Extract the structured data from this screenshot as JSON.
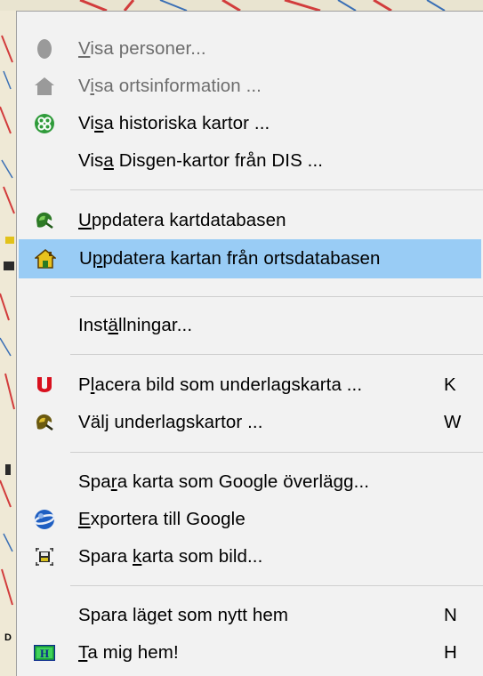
{
  "menu": {
    "items": [
      {
        "pre": "",
        "acc": "V",
        "post": "isa personer...",
        "key": "",
        "disabled": true,
        "icon": "person-icon"
      },
      {
        "pre": "V",
        "acc": "i",
        "post": "sa ortsinformation ...",
        "key": "",
        "disabled": true,
        "icon": "house-icon"
      },
      {
        "pre": "Vi",
        "acc": "s",
        "post": "a historiska kartor ...",
        "key": "",
        "disabled": false,
        "icon": "historical-maps-icon"
      },
      {
        "pre": "Vis",
        "acc": "a",
        "post": " Disgen-kartor från DIS ...",
        "key": "",
        "disabled": false,
        "icon": ""
      },
      {
        "pre": "",
        "acc": "U",
        "post": "ppdatera kartdatabasen",
        "key": "",
        "disabled": false,
        "icon": "map-update-icon"
      },
      {
        "pre": "U",
        "acc": "p",
        "post": "pdatera kartan från ortsdatabasen",
        "key": "",
        "disabled": false,
        "icon": "house-update-icon",
        "highlighted": true
      },
      {
        "pre": "Inst",
        "acc": "ä",
        "post": "llningar...",
        "key": "",
        "disabled": false,
        "icon": ""
      },
      {
        "pre": "P",
        "acc": "l",
        "post": "acera bild som underlagskarta ...",
        "key": "K",
        "disabled": false,
        "icon": "underlay-u-icon"
      },
      {
        "pre": "Väl",
        "acc": "j",
        "post": " underlagskartor ...",
        "key": "W",
        "disabled": false,
        "icon": "choose-underlay-icon"
      },
      {
        "pre": "Spa",
        "acc": "r",
        "post": "a karta som Google överlägg...",
        "key": "",
        "disabled": false,
        "icon": ""
      },
      {
        "pre": "",
        "acc": "E",
        "post": "xportera till Google",
        "key": "",
        "disabled": false,
        "icon": "google-earth-icon"
      },
      {
        "pre": "Spara ",
        "acc": "k",
        "post": "arta som bild...",
        "key": "",
        "disabled": false,
        "icon": "save-image-icon"
      },
      {
        "pre": "Spara lä",
        "acc": "g",
        "post": "et som nytt hem",
        "key": "N",
        "disabled": false,
        "icon": ""
      },
      {
        "pre": "",
        "acc": "T",
        "post": "a mig hem!",
        "key": "H",
        "disabled": false,
        "icon": "home-h-icon"
      }
    ]
  },
  "colors": {
    "highlight": "#99ccf5",
    "disabled_text": "#6d6d6d",
    "menu_bg": "#f2f2f2"
  }
}
